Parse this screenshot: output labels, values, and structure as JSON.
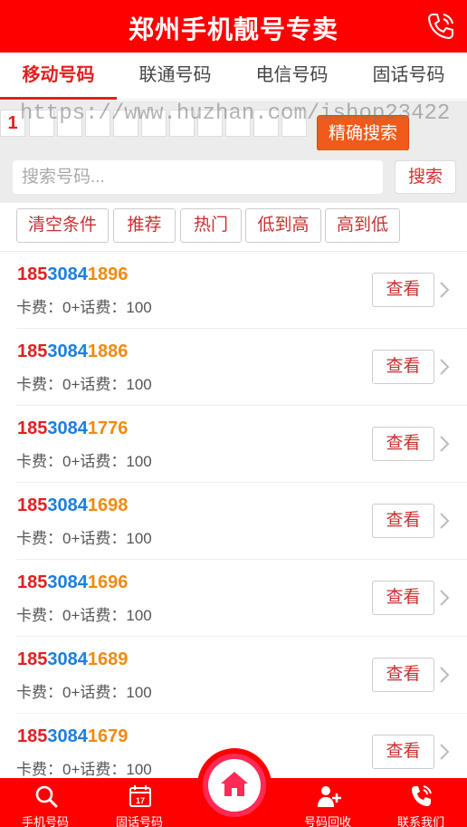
{
  "header": {
    "title": "郑州手机靓号专卖"
  },
  "tabs": [
    {
      "label": "移动号码",
      "active": true
    },
    {
      "label": "联通号码",
      "active": false
    },
    {
      "label": "电信号码",
      "active": false
    },
    {
      "label": "固话号码",
      "active": false
    }
  ],
  "precise": {
    "first_digit": "1",
    "button_label": "精确搜索"
  },
  "watermark": "https://www.huzhan.com/ishop23422",
  "search": {
    "placeholder": "搜索号码...",
    "button_label": "搜索"
  },
  "filters": [
    "清空条件",
    "推荐",
    "热门",
    "低到高",
    "高到低"
  ],
  "list": [
    {
      "p1": "185",
      "p2": "3084",
      "p3": "1896",
      "fee": "卡费：0+话费：100",
      "action": "查看"
    },
    {
      "p1": "185",
      "p2": "3084",
      "p3": "1886",
      "fee": "卡费：0+话费：100",
      "action": "查看"
    },
    {
      "p1": "185",
      "p2": "3084",
      "p3": "1776",
      "fee": "卡费：0+话费：100",
      "action": "查看"
    },
    {
      "p1": "185",
      "p2": "3084",
      "p3": "1698",
      "fee": "卡费：0+话费：100",
      "action": "查看"
    },
    {
      "p1": "185",
      "p2": "3084",
      "p3": "1696",
      "fee": "卡费：0+话费：100",
      "action": "查看"
    },
    {
      "p1": "185",
      "p2": "3084",
      "p3": "1689",
      "fee": "卡费：0+话费：100",
      "action": "查看"
    },
    {
      "p1": "185",
      "p2": "3084",
      "p3": "1679",
      "fee": "卡费：0+话费：100",
      "action": "查看"
    }
  ],
  "footer": {
    "items": [
      {
        "label": "手机号码",
        "icon": "search-icon"
      },
      {
        "label": "固话号码",
        "icon": "calendar-icon",
        "badge": "17"
      },
      {
        "label": "号码回收",
        "icon": "user-add-icon"
      },
      {
        "label": "联系我们",
        "icon": "phone-icon"
      }
    ],
    "home_icon": "home-icon"
  },
  "colors": {
    "brand": "#ff0000",
    "prefix": "#e02020",
    "middle": "#1a7fe0",
    "suffix": "#f08a12"
  }
}
